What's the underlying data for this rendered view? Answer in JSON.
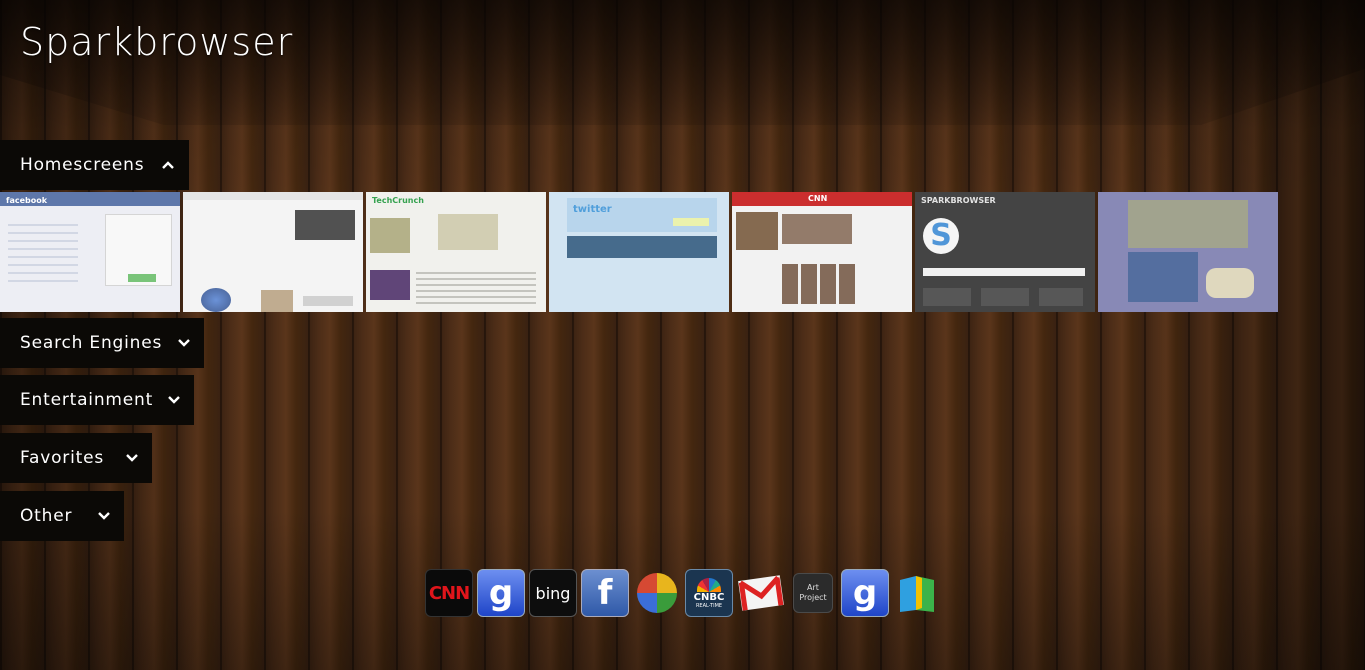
{
  "app": {
    "title": "Sparkbrowser"
  },
  "sections": [
    {
      "label": "Homescreens",
      "expanded": true
    },
    {
      "label": "Search Engines",
      "expanded": false
    },
    {
      "label": "Entertainment",
      "expanded": false
    },
    {
      "label": "Favorites",
      "expanded": false
    },
    {
      "label": "Other",
      "expanded": false
    }
  ],
  "homescreens": [
    {
      "name": "facebook",
      "caption": "facebook",
      "bg": "#e9ebf2",
      "accent": "#3b5998"
    },
    {
      "name": "google",
      "caption": "",
      "bg": "#f2f2f2",
      "accent": "#333333"
    },
    {
      "name": "techcrunch",
      "caption": "TechCrunch",
      "bg": "#eeeeea",
      "accent": "#0a8e2a"
    },
    {
      "name": "twitter",
      "caption": "twitter",
      "bg": "#c9dff0",
      "accent": "#2a8ad4"
    },
    {
      "name": "cnn",
      "caption": "CNN",
      "bg": "#efefef",
      "accent": "#c00000"
    },
    {
      "name": "sparkbrowser",
      "caption": "SPARKBROWSER",
      "bg": "#1c1c1c",
      "accent": "#2a7fd0"
    },
    {
      "name": "blog",
      "caption": "",
      "bg": "#6e6fa6",
      "accent": "#b79f6a"
    }
  ],
  "dock": [
    {
      "name": "cnn",
      "text": "CNN"
    },
    {
      "name": "google-search",
      "text": "g"
    },
    {
      "name": "bing",
      "text": "bing"
    },
    {
      "name": "facebook",
      "text": "f"
    },
    {
      "name": "google-buzz",
      "text": ""
    },
    {
      "name": "cnbc",
      "text": "CNBC",
      "subtext": "REAL-TIME"
    },
    {
      "name": "gmail",
      "text": "M"
    },
    {
      "name": "art-project",
      "text": "Art",
      "subtext": "Project"
    },
    {
      "name": "google-search-2",
      "text": "g"
    },
    {
      "name": "google-books",
      "text": ""
    }
  ],
  "colors": {
    "header_bg": "#0b0906",
    "text": "#ffffff",
    "wood": "#4b2c17"
  }
}
